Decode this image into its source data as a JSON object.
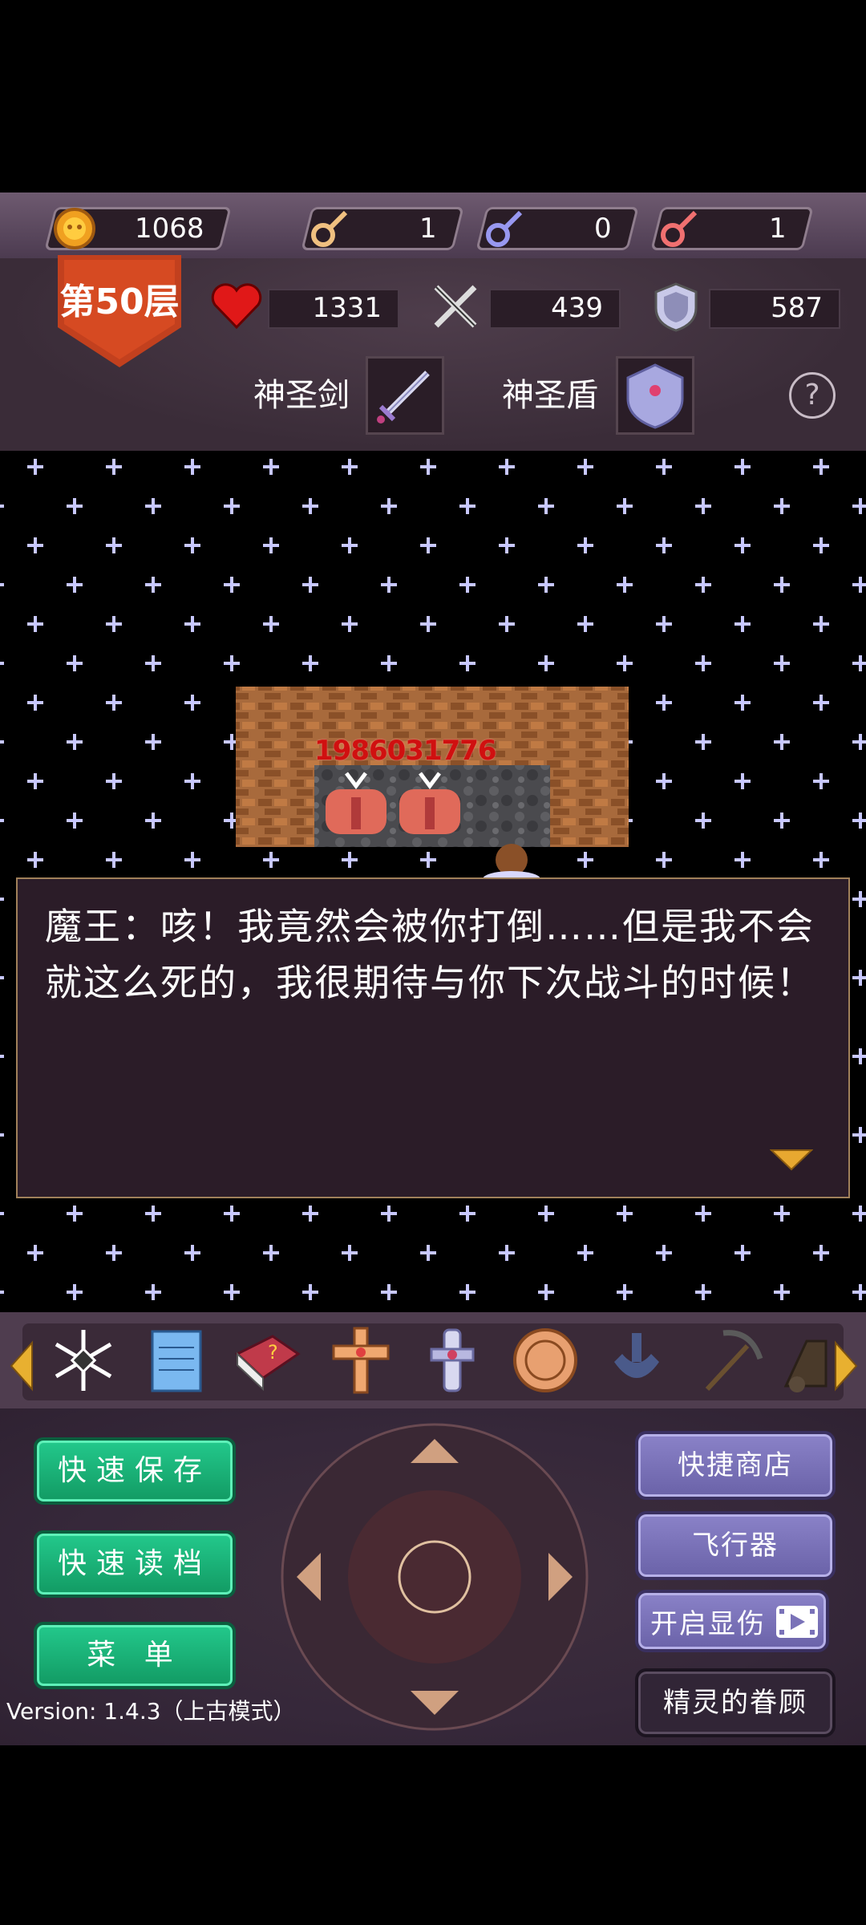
{
  "resources": {
    "gold": "1068",
    "yellow_key": "1",
    "blue_key": "0",
    "red_key": "1"
  },
  "hero": {
    "floor": "第50层",
    "hp": "1331",
    "attack": "439",
    "defense": "587",
    "weapon_label": "神圣剑",
    "shield_label": "神圣盾",
    "help": "?"
  },
  "map": {
    "damage_label": "1986031776"
  },
  "dialog": {
    "text": "魔王：咳！我竟然会被你打倒……但是我不会就这么死的，我很期待与你下次战斗的时候！"
  },
  "items": [
    "snowflake-item-icon",
    "notepad-item-icon",
    "monster-book-icon",
    "holy-cross-icon",
    "holy-water-icon",
    "magic-coin-icon",
    "teleport-icon",
    "pickaxe-icon",
    "bomb-icon"
  ],
  "controls": {
    "quick_save": "快速保存",
    "quick_load": "快速读档",
    "menu": "菜 单",
    "shop": "快捷商店",
    "flyer": "飞行器",
    "show_damage": "开启显伤",
    "spirit": "精灵的眷顾"
  },
  "version": "Version: 1.4.3（上古模式）",
  "colors": {
    "green_button": "#1bb278",
    "purple_button": "#7a72b8",
    "dialog_bg": "#2b1c28",
    "damage_text": "#d01010"
  }
}
